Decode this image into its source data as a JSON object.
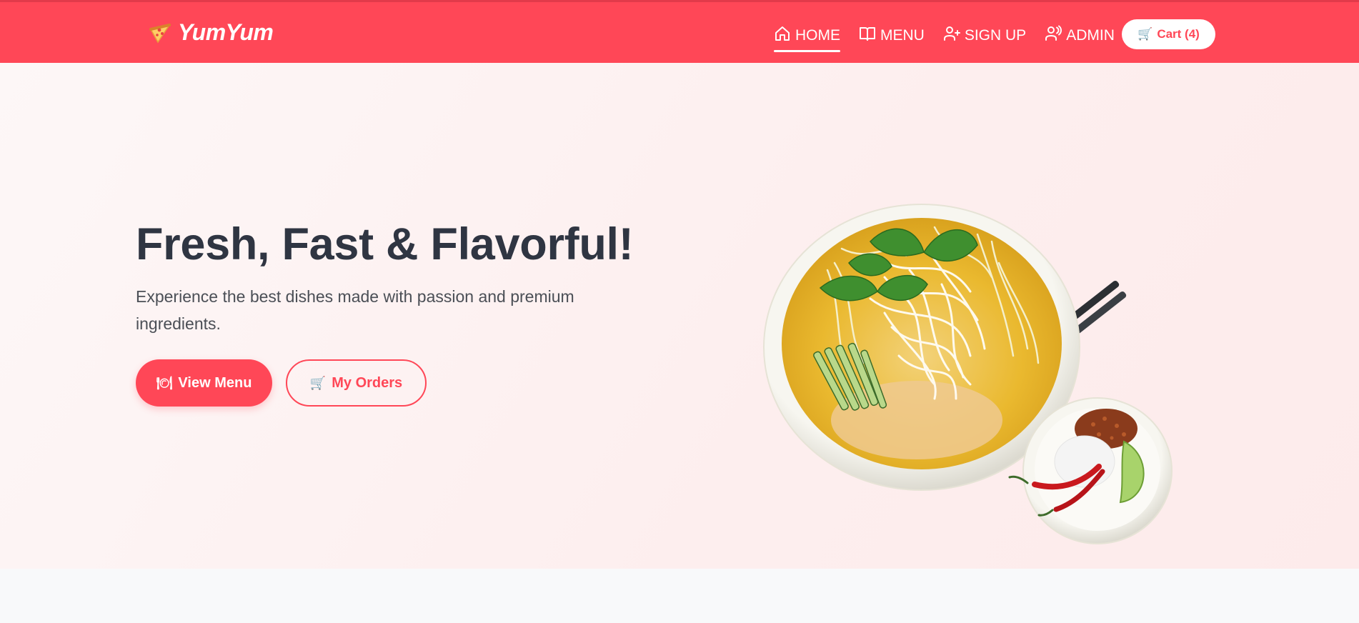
{
  "navbar": {
    "brand": "YumYum",
    "brand_icon": "pizza-icon",
    "links": [
      {
        "label": "HOME",
        "icon": "home-icon",
        "active": true
      },
      {
        "label": "MENU",
        "icon": "book-icon",
        "active": false
      },
      {
        "label": "SIGN UP",
        "icon": "user-plus-icon",
        "active": false
      },
      {
        "label": "ADMIN",
        "icon": "admin-user-icon",
        "active": false
      }
    ],
    "cart": {
      "label": "Cart (4)",
      "icon": "cart-icon"
    }
  },
  "hero": {
    "title": "Fresh, Fast & Flavorful!",
    "subtitle": "Experience the best dishes made with passion and premium ingredients.",
    "primary_button": {
      "label": "View Menu",
      "icon": "plate-icon"
    },
    "secondary_button": {
      "label": "My Orders",
      "icon": "cart-icon"
    },
    "image": "noodle-soup-bowl-image"
  },
  "colors": {
    "accent": "#ff4757",
    "text_dark": "#2f3542",
    "text_body": "#4b4f56",
    "hero_bg": "#fdf0f0",
    "page_bg": "#f8f9fa"
  }
}
